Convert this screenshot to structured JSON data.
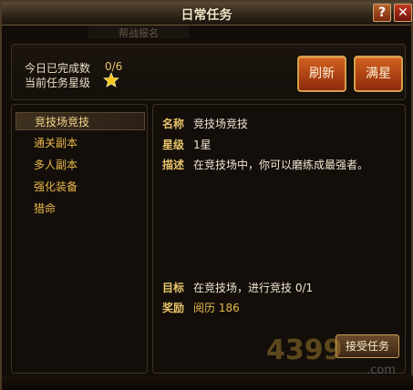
{
  "window": {
    "title": "日常任务",
    "help_label": "?",
    "close_label": "✕",
    "faded_tab_text": "帮战报名"
  },
  "stats": {
    "completed_label": "今日已完成数",
    "completed_value": "0/6",
    "star_label": "当前任务星级",
    "star_icon": "star-icon",
    "star_color": "#f5c518",
    "refresh_label": "刷新",
    "fullstar_label": "满星"
  },
  "task_list": [
    {
      "label": "竞技场竞技",
      "selected": true
    },
    {
      "label": "通关副本",
      "selected": false
    },
    {
      "label": "多人副本",
      "selected": false
    },
    {
      "label": "强化装备",
      "selected": false
    },
    {
      "label": "猎命",
      "selected": false
    }
  ],
  "detail": {
    "name_label": "名称",
    "name_value": "竞技场竞技",
    "star_label": "星级",
    "star_value": "1星",
    "desc_label": "描述",
    "desc_value": "在竞技场中，你可以磨练成最强者。",
    "goal_label": "目标",
    "goal_value": "在竞技场，进行竞技 0/1",
    "reward_label": "奖励",
    "reward_value": "阅历 186",
    "accept_label": "接受任务"
  },
  "watermark": {
    "text": "4399",
    "suffix": ".com"
  },
  "colors": {
    "accent_gold": "#e8c36a",
    "button_orange": "#d3621f",
    "panel_border": "#3e3122"
  }
}
